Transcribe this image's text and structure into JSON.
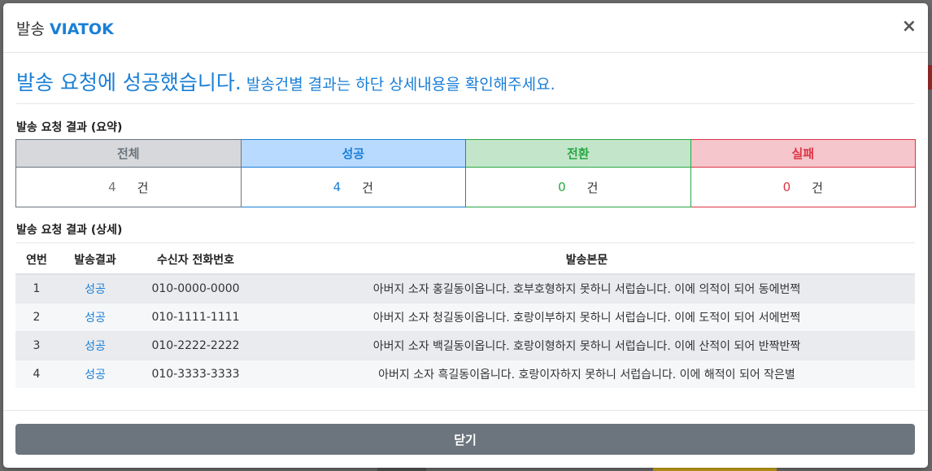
{
  "modal": {
    "title_prefix": "발송",
    "title_brand": "VIATOK",
    "close_symbol": "×"
  },
  "headline": {
    "main": "발송 요청에 성공했습니다.",
    "sub": "발송건별 결과는 하단 상세내용을 확인해주세요."
  },
  "summary": {
    "label": "발송 요청 결과 (요약)",
    "unit": "건",
    "columns": [
      {
        "header": "전체",
        "count": "4"
      },
      {
        "header": "성공",
        "count": "4"
      },
      {
        "header": "전환",
        "count": "0"
      },
      {
        "header": "실패",
        "count": "0"
      }
    ]
  },
  "detail": {
    "label": "발송 요청 결과 (상세)",
    "headers": [
      "연번",
      "발송결과",
      "수신자 전화번호",
      "발송본문"
    ],
    "rows": [
      {
        "no": "1",
        "status": "성공",
        "phone": "010-0000-0000",
        "body": "아버지 소자 홍길동이옵니다. 호부호형하지 못하니 서럽습니다. 이에 의적이 되어 동에번쩍"
      },
      {
        "no": "2",
        "status": "성공",
        "phone": "010-1111-1111",
        "body": "아버지 소자 청길동이옵니다. 호랑이부하지 못하니 서럽습니다. 이에 도적이 되어 서에번쩍"
      },
      {
        "no": "3",
        "status": "성공",
        "phone": "010-2222-2222",
        "body": "아버지 소자 백길동이옵니다. 호랑이형하지 못하니 서럽습니다. 이에 산적이 되어 반짝반짝"
      },
      {
        "no": "4",
        "status": "성공",
        "phone": "010-3333-3333",
        "body": "아버지 소자 흑길동이옵니다. 호랑이자하지 못하니 서럽습니다. 이에 해적이 되어 작은별"
      }
    ]
  },
  "footer": {
    "close_label": "닫기"
  },
  "colors": {
    "total": "#6c757d",
    "success": "#1a7fd6",
    "convert": "#28a745",
    "fail": "#dc3545"
  }
}
